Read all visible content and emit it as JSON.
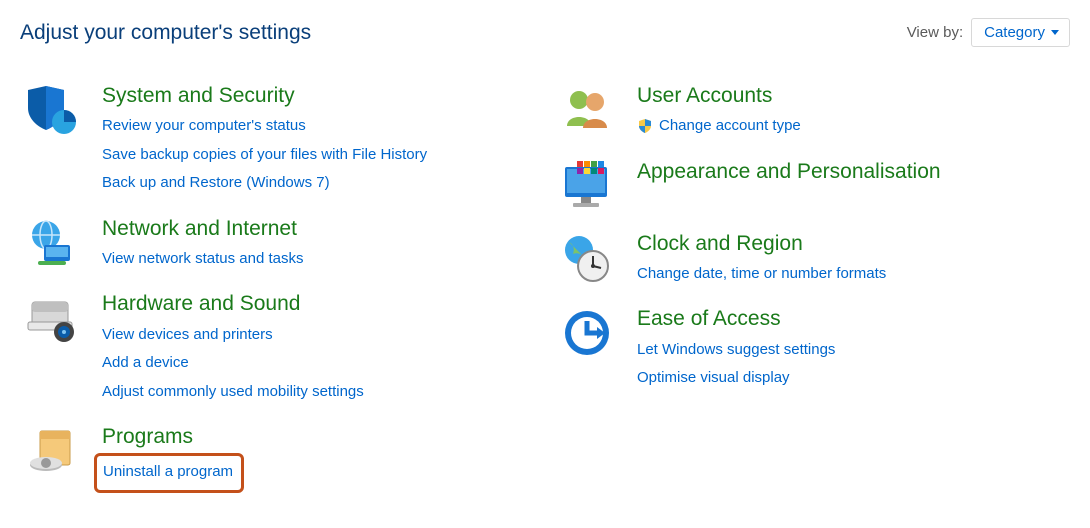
{
  "page_title": "Adjust your computer's settings",
  "view_by": {
    "label": "View by:",
    "selected": "Category"
  },
  "left": [
    {
      "icon": "shield-system-icon",
      "title": "System and Security",
      "links": [
        "Review your computer's status",
        "Save backup copies of your files with File History",
        "Back up and Restore (Windows 7)"
      ]
    },
    {
      "icon": "network-icon",
      "title": "Network and Internet",
      "links": [
        "View network status and tasks"
      ]
    },
    {
      "icon": "hardware-icon",
      "title": "Hardware and Sound",
      "links": [
        "View devices and printers",
        "Add a device",
        "Adjust commonly used mobility settings"
      ]
    },
    {
      "icon": "programs-icon",
      "title": "Programs",
      "links": [
        "Uninstall a program"
      ],
      "highlight": 0
    }
  ],
  "right": [
    {
      "icon": "user-accounts-icon",
      "title": "User Accounts",
      "links": [
        "Change account type"
      ],
      "shield_on": [
        0
      ]
    },
    {
      "icon": "appearance-icon",
      "title": "Appearance and Personalisation",
      "links": []
    },
    {
      "icon": "clock-region-icon",
      "title": "Clock and Region",
      "links": [
        "Change date, time or number formats"
      ]
    },
    {
      "icon": "ease-of-access-icon",
      "title": "Ease of Access",
      "links": [
        "Let Windows suggest settings",
        "Optimise visual display"
      ]
    }
  ]
}
